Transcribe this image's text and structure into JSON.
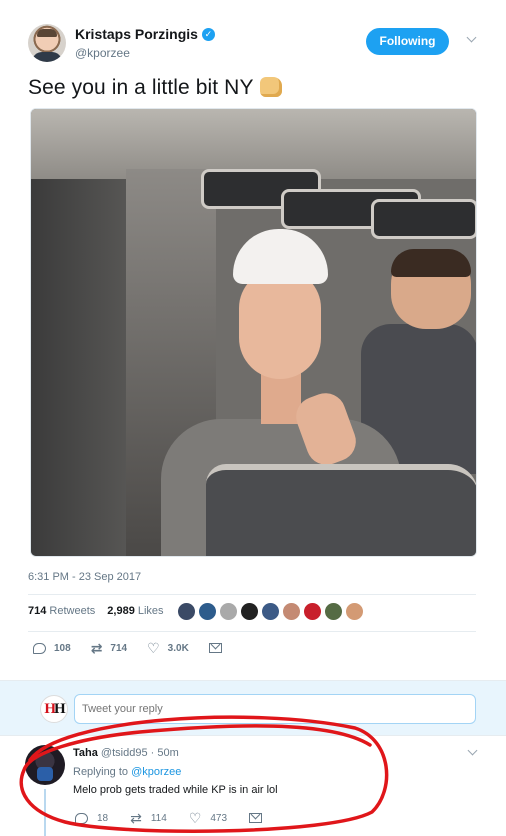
{
  "tweet": {
    "display_name": "Kristaps Porzingis",
    "handle": "@kporzee",
    "follow_label": "Following",
    "text": "See you in a little bit NY",
    "timestamp": "6:31 PM - 23 Sep 2017",
    "retweets_count": "714",
    "retweets_label": "Retweets",
    "likes_count": "2,989",
    "likes_label": "Likes",
    "actions": {
      "replies": "108",
      "retweets": "714",
      "likes": "3.0K"
    }
  },
  "reply_box": {
    "placeholder": "Tweet your reply"
  },
  "reply": {
    "display_name": "Taha",
    "handle_time": "@tsidd95 · 50m",
    "replying_prefix": "Replying to",
    "replying_to": "@kporzee",
    "text": "Melo prob gets traded while KP is in air lol",
    "actions": {
      "replies": "18",
      "retweets": "114",
      "likes": "473"
    }
  },
  "likers": [
    "#3b4a66",
    "#2d5c8c",
    "#a9a9a9",
    "#222222",
    "#3c5a86",
    "#c48a73",
    "#c81f2b",
    "#556b44",
    "#d39a74"
  ],
  "colors": {
    "accent": "#1da1f2",
    "annotation": "#e0161a"
  }
}
